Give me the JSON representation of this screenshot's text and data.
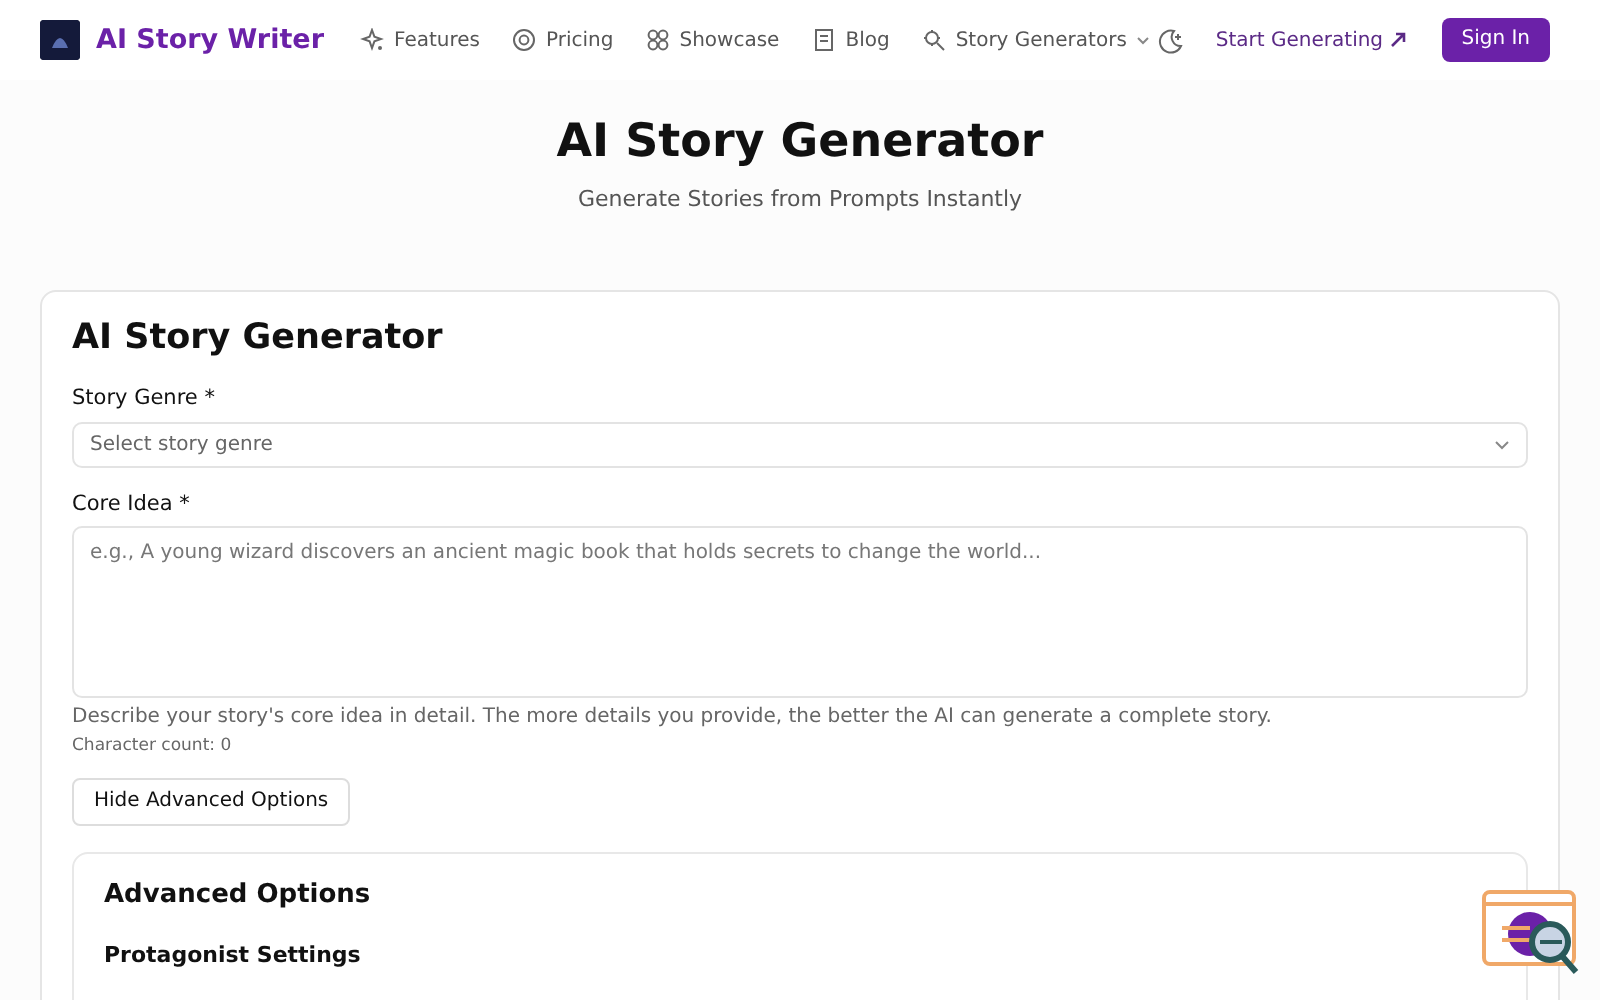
{
  "brand": {
    "name": "AI Story Writer"
  },
  "nav": [
    {
      "label": "Features",
      "kind": "sparkle"
    },
    {
      "label": "Pricing",
      "kind": "coin"
    },
    {
      "label": "Showcase",
      "kind": "grid"
    },
    {
      "label": "Blog",
      "kind": "doc"
    },
    {
      "label": "Story Generators",
      "kind": "dropdown"
    }
  ],
  "actions": {
    "start": "Start Generating",
    "sign_in": "Sign In"
  },
  "hero": {
    "title": "AI Story Generator",
    "subtitle": "Generate Stories from Prompts Instantly"
  },
  "form": {
    "title": "AI Story Generator",
    "fields": [
      {
        "kind": "select",
        "label": "Story Genre *",
        "placeholder": "Select story genre"
      },
      {
        "kind": "textarea",
        "label": "Core Idea *",
        "placeholder": "e.g., A young wizard discovers an ancient magic book that holds secrets to change the world...",
        "help": "Describe your story's core idea in detail. The more details you provide, the better the AI can generate a complete story.",
        "count": "Character count: 0"
      }
    ],
    "toggle_button": "Hide Advanced Options",
    "advanced": {
      "title": "Advanced Options",
      "section": "Protagonist Settings"
    }
  }
}
